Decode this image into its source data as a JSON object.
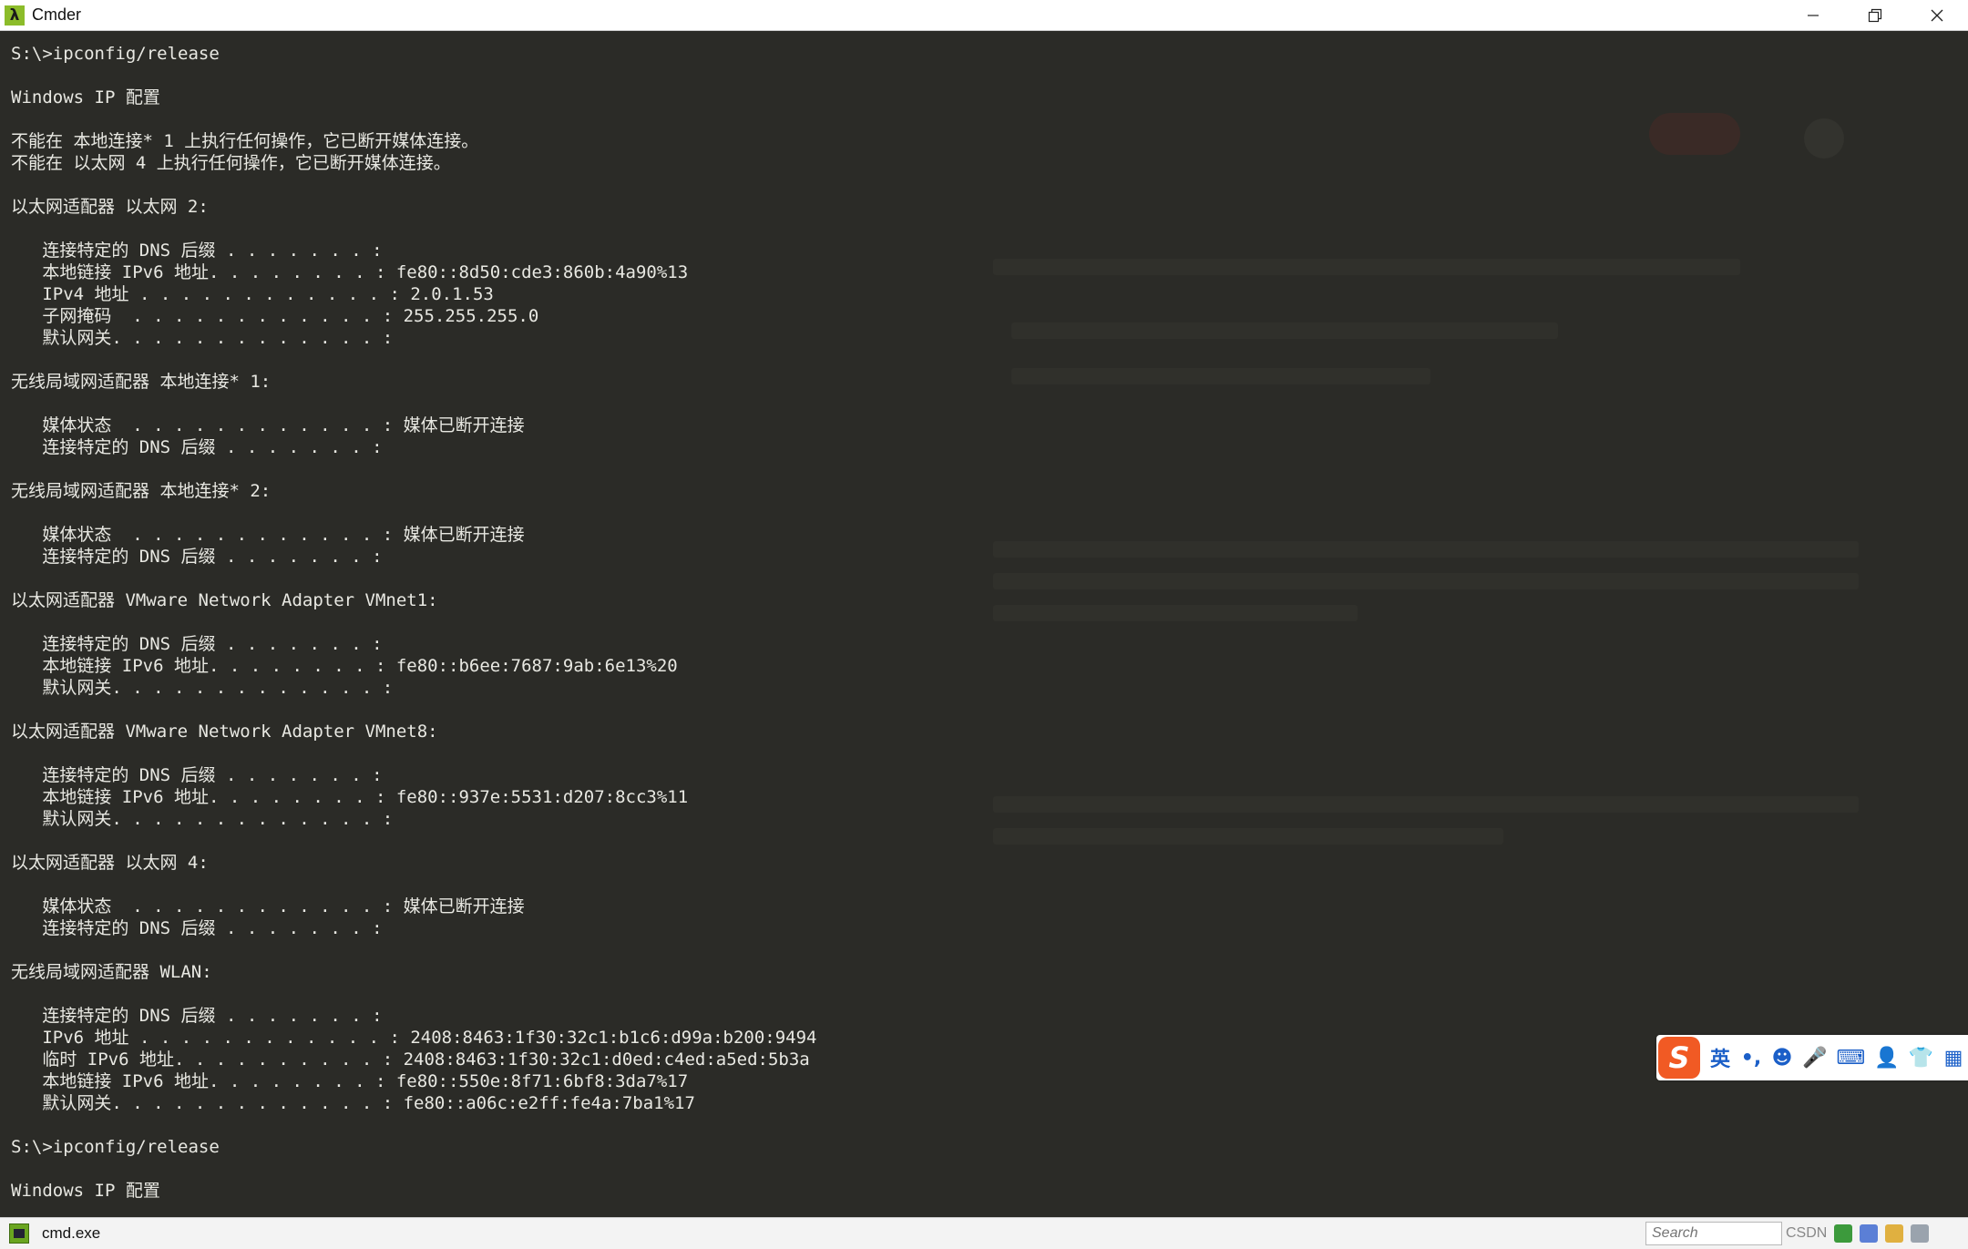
{
  "window": {
    "title": "Cmder",
    "app_icon_glyph": "λ",
    "controls": [
      "minimize-icon",
      "restore-icon",
      "close-icon"
    ]
  },
  "terminal": {
    "lines": [
      "S:\\>ipconfig/release",
      "",
      "Windows IP 配置",
      "",
      "不能在 本地连接* 1 上执行任何操作，它已断开媒体连接。",
      "不能在 以太网 4 上执行任何操作，它已断开媒体连接。",
      "",
      "以太网适配器 以太网 2:",
      "",
      "   连接特定的 DNS 后缀 . . . . . . . :",
      "   本地链接 IPv6 地址. . . . . . . . : fe80::8d50:cde3:860b:4a90%13",
      "   IPv4 地址 . . . . . . . . . . . . : 2.0.1.53",
      "   子网掩码  . . . . . . . . . . . . : 255.255.255.0",
      "   默认网关. . . . . . . . . . . . . :",
      "",
      "无线局域网适配器 本地连接* 1:",
      "",
      "   媒体状态  . . . . . . . . . . . . : 媒体已断开连接",
      "   连接特定的 DNS 后缀 . . . . . . . :",
      "",
      "无线局域网适配器 本地连接* 2:",
      "",
      "   媒体状态  . . . . . . . . . . . . : 媒体已断开连接",
      "   连接特定的 DNS 后缀 . . . . . . . :",
      "",
      "以太网适配器 VMware Network Adapter VMnet1:",
      "",
      "   连接特定的 DNS 后缀 . . . . . . . :",
      "   本地链接 IPv6 地址. . . . . . . . : fe80::b6ee:7687:9ab:6e13%20",
      "   默认网关. . . . . . . . . . . . . :",
      "",
      "以太网适配器 VMware Network Adapter VMnet8:",
      "",
      "   连接特定的 DNS 后缀 . . . . . . . :",
      "   本地链接 IPv6 地址. . . . . . . . : fe80::937e:5531:d207:8cc3%11",
      "   默认网关. . . . . . . . . . . . . :",
      "",
      "以太网适配器 以太网 4:",
      "",
      "   媒体状态  . . . . . . . . . . . . : 媒体已断开连接",
      "   连接特定的 DNS 后缀 . . . . . . . :",
      "",
      "无线局域网适配器 WLAN:",
      "",
      "   连接特定的 DNS 后缀 . . . . . . . :",
      "   IPv6 地址 . . . . . . . . . . . . : 2408:8463:1f30:32c1:b1c6:d99a:b200:9494",
      "   临时 IPv6 地址. . . . . . . . . . : 2408:8463:1f30:32c1:d0ed:c4ed:a5ed:5b3a",
      "   本地链接 IPv6 地址. . . . . . . . : fe80::550e:8f71:6bf8:3da7%17",
      "   默认网关. . . . . . . . . . . . . : fe80::a06c:e2ff:fe4a:7ba1%17",
      "",
      "S:\\>ipconfig/release",
      "",
      "Windows IP 配置"
    ]
  },
  "ime": {
    "logo": "S",
    "items": [
      "英",
      "•,",
      "☻",
      "🎤",
      "⌨",
      "👤",
      "👕",
      "▦"
    ]
  },
  "statusbar": {
    "tab_label": "cmd.exe",
    "search_placeholder": "Search",
    "tray_text": "CSDN"
  },
  "colors": {
    "terminal_bg": "#2b2b27",
    "terminal_fg": "#e8e8e2",
    "ime_accent": "#1b5fc8",
    "ime_logo": "#f15a24"
  }
}
